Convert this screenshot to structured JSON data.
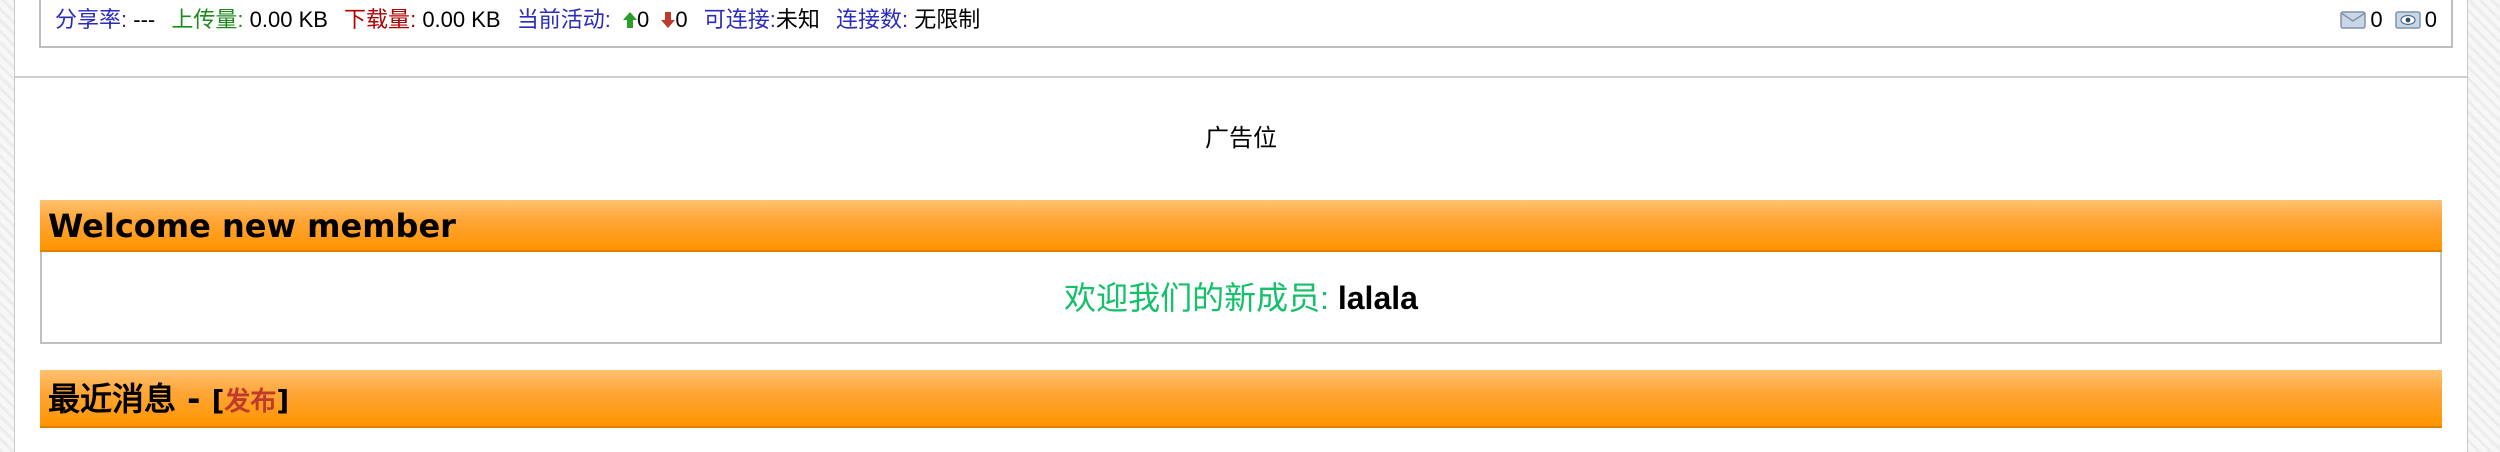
{
  "status_bar": {
    "share_ratio": {
      "label": "分享率",
      "value": "---"
    },
    "uploaded": {
      "label": "上传量",
      "value": "0.00 KB"
    },
    "downloaded": {
      "label": "下载量",
      "value": "0.00 KB"
    },
    "active": {
      "label": "当前活动",
      "seeding": "0",
      "leeching": "0"
    },
    "connectable": {
      "label": "可连接",
      "value": "未知"
    },
    "connections": {
      "label": "连接数",
      "value": "无限制"
    },
    "messages": {
      "inbox_icon": "envelope-icon",
      "inbox_count": "0",
      "sent_icon": "eye-mail-icon",
      "sent_count": "0"
    }
  },
  "ad": {
    "text": "广告位"
  },
  "welcome": {
    "title": "Welcome new member",
    "prefix": "欢迎我们的新成员: ",
    "member_name": "lalala"
  },
  "news": {
    "title": "最近消息 - ",
    "post_link": "发布"
  },
  "colors": {
    "header_orange": "#ff9400",
    "welcome_green": "#14c06a",
    "label_blue": "#2b2bbf",
    "upload_green": "#1d8a1d",
    "download_red": "#b00000",
    "post_link_red": "#c0392b"
  }
}
